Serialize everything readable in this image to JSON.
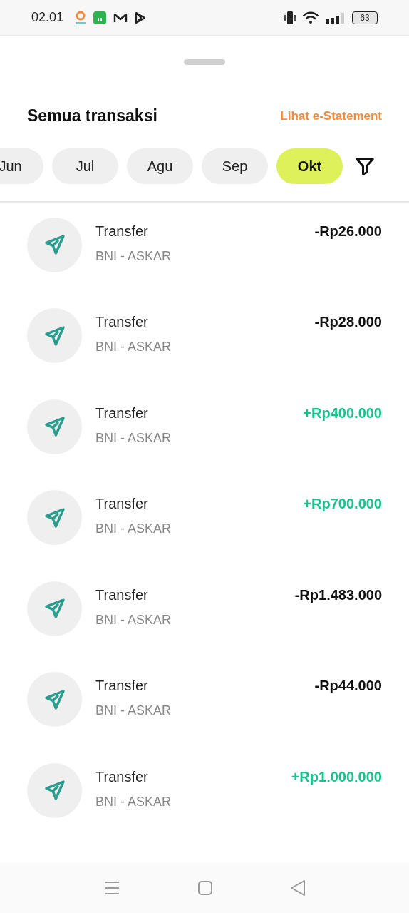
{
  "status_bar": {
    "time": "02.01",
    "battery": "63"
  },
  "header": {
    "title": "Semua transaksi",
    "link": "Lihat e-Statement"
  },
  "months": [
    {
      "label": "Jun",
      "selected": false
    },
    {
      "label": "Jul",
      "selected": false
    },
    {
      "label": "Agu",
      "selected": false
    },
    {
      "label": "Sep",
      "selected": false
    },
    {
      "label": "Okt",
      "selected": true
    }
  ],
  "transactions": [
    {
      "title": "Transfer",
      "subtitle": "BNI - ASKAR",
      "amount": "-Rp26.000",
      "kind": "debit"
    },
    {
      "title": "Transfer",
      "subtitle": "BNI - ASKAR",
      "amount": "-Rp28.000",
      "kind": "debit"
    },
    {
      "title": "Transfer",
      "subtitle": "BNI - ASKAR",
      "amount": "+Rp400.000",
      "kind": "credit"
    },
    {
      "title": "Transfer",
      "subtitle": "BNI - ASKAR",
      "amount": "+Rp700.000",
      "kind": "credit"
    },
    {
      "title": "Transfer",
      "subtitle": "BNI - ASKAR",
      "amount": "-Rp1.483.000",
      "kind": "debit"
    },
    {
      "title": "Transfer",
      "subtitle": "BNI - ASKAR",
      "amount": "-Rp44.000",
      "kind": "debit"
    },
    {
      "title": "Transfer",
      "subtitle": "BNI - ASKAR",
      "amount": "+Rp1.000.000",
      "kind": "credit"
    }
  ]
}
